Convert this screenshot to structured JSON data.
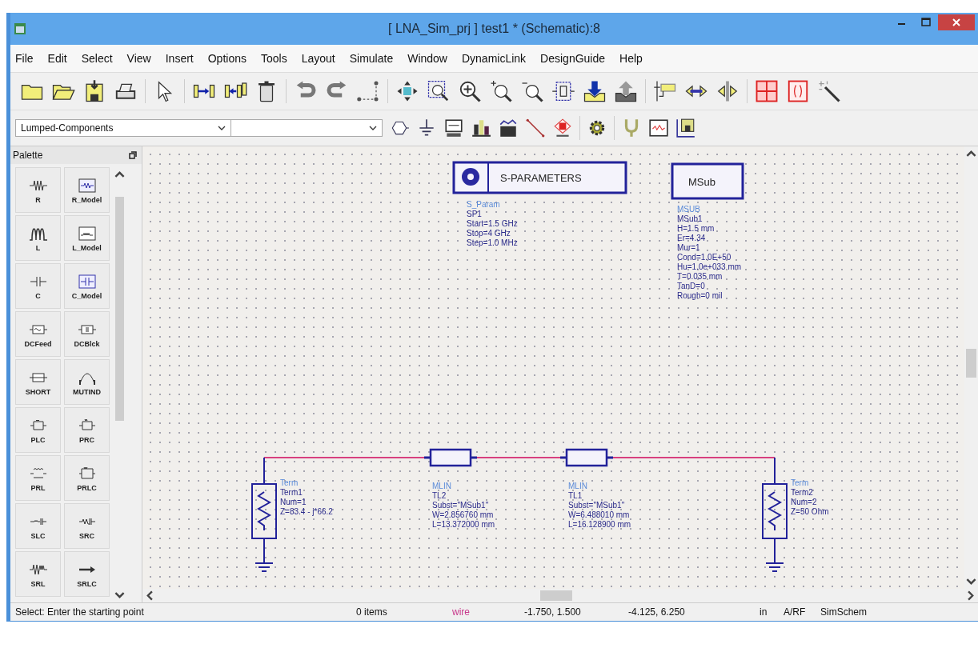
{
  "window": {
    "title": "[ LNA_Sim_prj ] test1 * (Schematic):8"
  },
  "menu": [
    "File",
    "Edit",
    "Select",
    "View",
    "Insert",
    "Options",
    "Tools",
    "Layout",
    "Simulate",
    "Window",
    "DynamicLink",
    "DesignGuide",
    "Help"
  ],
  "library_select": {
    "value": "Lumped-Components"
  },
  "palette": {
    "title": "Palette",
    "items": [
      {
        "label": "R"
      },
      {
        "label": "R_Model"
      },
      {
        "label": "L"
      },
      {
        "label": "L_Model"
      },
      {
        "label": "C"
      },
      {
        "label": "C_Model"
      },
      {
        "label": "DCFeed"
      },
      {
        "label": "DCBlck"
      },
      {
        "label": "SHORT"
      },
      {
        "label": "MUTIND"
      },
      {
        "label": "PLC"
      },
      {
        "label": "PRC"
      },
      {
        "label": "PRL"
      },
      {
        "label": "PRLC"
      },
      {
        "label": "SLC"
      },
      {
        "label": "SRC"
      },
      {
        "label": "SRL"
      },
      {
        "label": "SRLC"
      }
    ]
  },
  "schematic": {
    "components": [
      {
        "kind": "sparam",
        "label": "S-PARAMETERS",
        "lines": [
          "S_Param",
          "SP1",
          "Start=1.5 GHz",
          "Stop=4 GHz",
          "Step=1.0 MHz"
        ]
      },
      {
        "kind": "msub",
        "label": "MSub",
        "lines": [
          "MSUB",
          "MSub1",
          "H=1.5 mm",
          "Er=4.34",
          "Mur=1",
          "Cond=1.0E+50",
          "Hu=1.0e+033 mm",
          "T=0.035 mm",
          "TanD=0",
          "Rough=0 mil"
        ]
      },
      {
        "kind": "term",
        "lines": [
          "Term",
          "Term1",
          "Num=1",
          "Z=83.4 - j*66.2"
        ]
      },
      {
        "kind": "mlin",
        "lines": [
          "MLIN",
          "TL2",
          "Subst=\"MSub1\"",
          "W=2.856760 mm",
          "L=13.372000 mm"
        ]
      },
      {
        "kind": "mlin",
        "lines": [
          "MLIN",
          "TL1",
          "Subst=\"MSub1\"",
          "W=6.488010 mm",
          "L=16.128900 mm"
        ]
      },
      {
        "kind": "term",
        "lines": [
          "Term",
          "Term2",
          "Num=2",
          "Z=50 Ohm"
        ]
      }
    ]
  },
  "status_bar": [
    {
      "text": "Select: Enter the starting point",
      "kind": "text"
    },
    {
      "text": "0 items",
      "kind": "text"
    },
    {
      "text": "wire",
      "kind": "mode"
    },
    {
      "text": "-1.750, 1.500",
      "kind": "text"
    },
    {
      "text": "-4.125, 6.250",
      "kind": "text"
    },
    {
      "text": "in",
      "kind": "text"
    },
    {
      "text": "A/RF",
      "kind": "text"
    },
    {
      "text": "SimSchem",
      "kind": "text"
    }
  ]
}
